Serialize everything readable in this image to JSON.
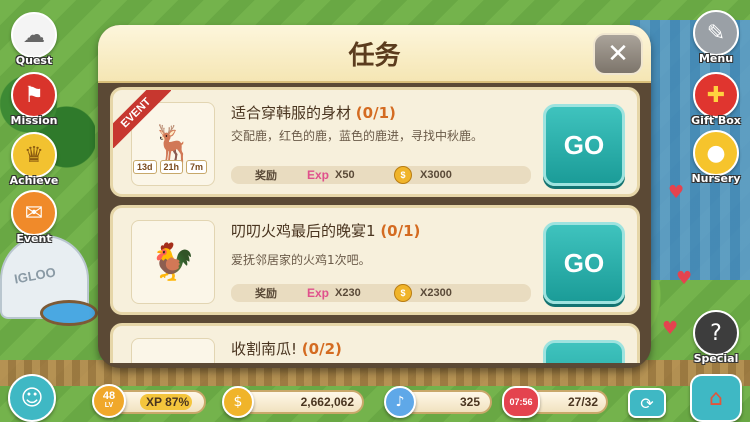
{
  "modal": {
    "title": "任务",
    "close_label": "✕"
  },
  "side_menu_left": [
    {
      "label": "Quest",
      "icon": "sheep-icon"
    },
    {
      "label": "Mission",
      "icon": "flag-icon"
    },
    {
      "label": "Achieve",
      "icon": "trophy-icon"
    },
    {
      "label": "Event",
      "icon": "gift-event-icon"
    }
  ],
  "side_menu_right": [
    {
      "label": "Menu",
      "icon": "wrench-icon"
    },
    {
      "label": "Gift Box",
      "icon": "gift-box-icon"
    },
    {
      "label": "Nursery",
      "icon": "egg-icon"
    },
    {
      "label": "Special",
      "icon": "question-icon"
    }
  ],
  "tasks": [
    {
      "event_label": "EVENT",
      "timer": [
        "13d",
        "21h",
        "7m"
      ],
      "title": "适合穿韩服的身材",
      "progress": "(0/1)",
      "description": "交配鹿，红色的鹿，蓝色的鹿进，寻找中秋鹿。",
      "reward_label": "奖励",
      "exp_tag": "Exp",
      "exp_value": "X50",
      "coin_value": "X3000",
      "go_label": "GO"
    },
    {
      "title": "叨叨火鸡最后的晚宴1",
      "progress": "(0/1)",
      "description": "爱抚邻居家的火鸡1次吧。",
      "reward_label": "奖励",
      "exp_tag": "Exp",
      "exp_value": "X230",
      "coin_value": "X2300",
      "go_label": "GO"
    },
    {
      "title": "收割南瓜!",
      "progress": "(0/2)",
      "go_label": ""
    }
  ],
  "status_bar": {
    "level": "48",
    "level_suffix": "LV",
    "xp_text": "XP 87%",
    "xp_fraction": 0.87,
    "coins": "2,662,062",
    "gems": "325",
    "energy_timer": "07:56",
    "energy": "27/32"
  },
  "colors": {
    "go_button": "#2bb2ad",
    "modal_frame": "#5b4935",
    "header_bg": "#f5e6b4",
    "event_ribbon": "#c7372f",
    "progress_text": "#d46b21"
  }
}
